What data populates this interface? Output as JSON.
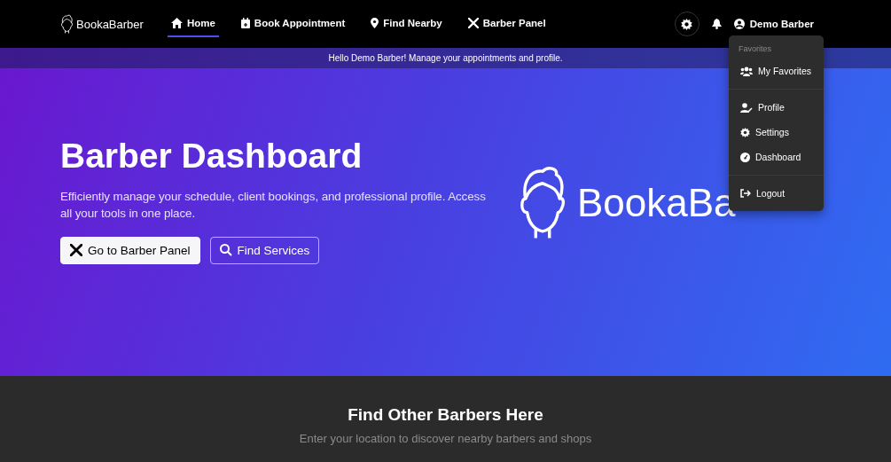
{
  "brand": {
    "name": "BookaBarber"
  },
  "nav": [
    {
      "label": "Home",
      "selected": true
    },
    {
      "label": "Book Appointment",
      "selected": false
    },
    {
      "label": "Find Nearby",
      "selected": false
    },
    {
      "label": "Barber Panel",
      "selected": false
    }
  ],
  "user": {
    "name": "Demo Barber"
  },
  "banner": {
    "text": "Hello Demo Barber! Manage your appointments and profile."
  },
  "user_menu": {
    "sections": [
      {
        "header": "Favorites",
        "items": [
          "My Favorites"
        ]
      },
      {
        "items": [
          "Profile",
          "Settings",
          "Dashboard"
        ]
      },
      {
        "items": [
          "Logout"
        ]
      }
    ]
  },
  "hero": {
    "title": "Barber Dashboard",
    "text": "Efficiently manage your schedule, client bookings, and professional profile. Access all your tools in one place.",
    "buttons": [
      {
        "label": "Go to Barber Panel",
        "kind": "primary"
      },
      {
        "label": "Find Services",
        "kind": "outline"
      }
    ],
    "logo_text": "BookaBa"
  },
  "find": {
    "title": "Find Other Barbers Here",
    "subtitle": "Enter your location to discover nearby barbers and shops"
  }
}
